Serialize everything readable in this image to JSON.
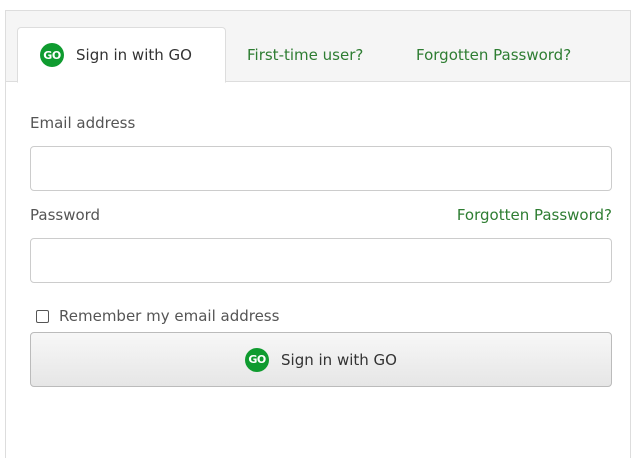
{
  "tabs": [
    {
      "label": "Sign in with GO",
      "active": true,
      "logo_text": "GO"
    },
    {
      "label": "First-time user?"
    },
    {
      "label": "Forgotten Password?"
    }
  ],
  "form": {
    "email_label": "Email address",
    "email_value": "",
    "password_label": "Password",
    "password_value": "",
    "forgot_link": "Forgotten Password?",
    "remember_label": "Remember my email address",
    "remember_checked": false,
    "submit_label": "Sign in with GO",
    "submit_logo_text": "GO"
  },
  "colors": {
    "accent_green": "#2e7d32",
    "logo_green": "#0f9b2f"
  }
}
